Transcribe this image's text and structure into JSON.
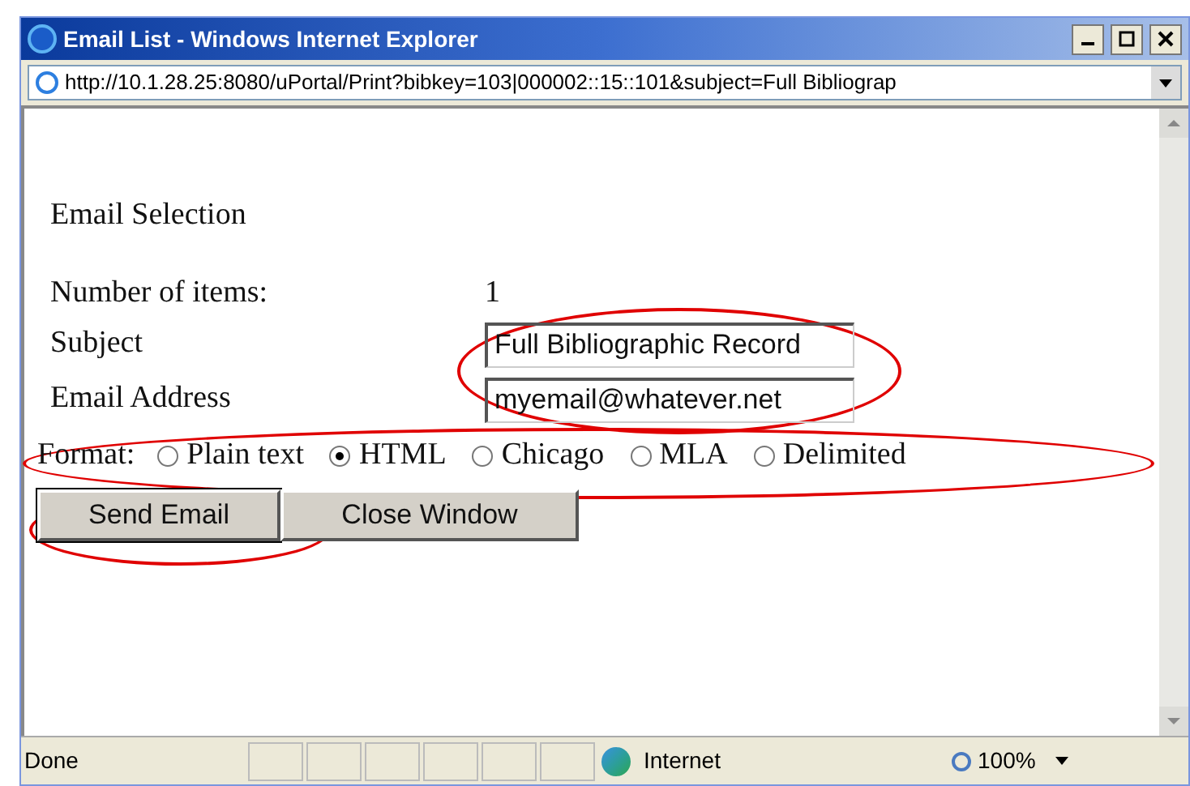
{
  "window": {
    "title": "Email List - Windows Internet Explorer"
  },
  "address": "http://10.1.28.25:8080/uPortal/Print?bibkey=103|000002::15::101&subject=Full Bibliograp",
  "form": {
    "heading": "Email Selection",
    "items_label": "Number of items:",
    "items_value": "1",
    "subject_label": "Subject",
    "subject_value": "Full Bibliographic Record",
    "email_label": "Email Address",
    "email_value": "myemail@whatever.net",
    "format_label": "Format:",
    "formats": [
      {
        "label": "Plain text",
        "selected": false
      },
      {
        "label": "HTML",
        "selected": true
      },
      {
        "label": "Chicago",
        "selected": false
      },
      {
        "label": "MLA",
        "selected": false
      },
      {
        "label": "Delimited",
        "selected": false
      }
    ],
    "buttons": [
      "Send Email",
      "Close Window"
    ]
  },
  "status_bar": {
    "text": "Done",
    "zone": "Internet",
    "zoom": "100%"
  }
}
